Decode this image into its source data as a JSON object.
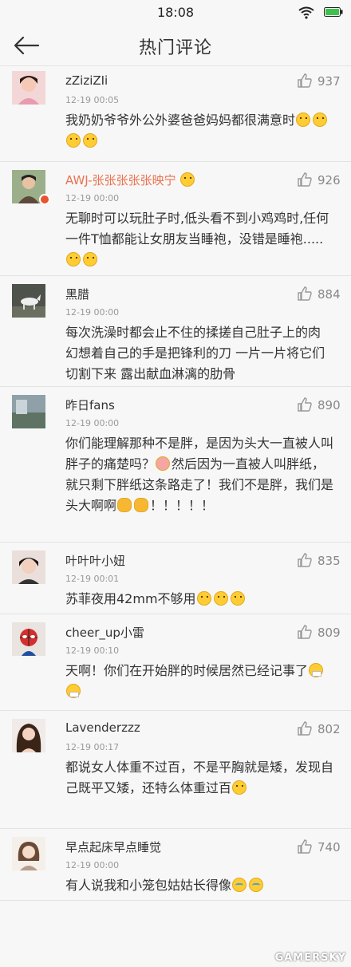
{
  "status_bar": {
    "time": "18:08",
    "wifi_icon": "wifi-icon",
    "battery_icon": "battery-icon"
  },
  "nav": {
    "back_icon": "back-arrow-icon",
    "title": "热门评论"
  },
  "comments": [
    {
      "user": "zZiziZIi",
      "time": "12-19 00:05",
      "likes": "937",
      "avatar": "avatar-girl-pink",
      "text": "我奶奶爷爷外公外婆爸爸妈妈都很满意时",
      "emojis": [
        "face",
        "face",
        "face",
        "face"
      ]
    },
    {
      "user": "AWJ-张张张张张映宁",
      "time": "12-19 00:00",
      "likes": "926",
      "avatar": "avatar-boy-green",
      "vip": true,
      "text": "无聊时可以玩肚子时,低头看不到小鸡鸡时,任何一件T恤都能让女朋友当睡袍，没错是睡袍.....",
      "emojis": [
        "face",
        "face"
      ]
    },
    {
      "user": "黑腊",
      "time": "12-19 00:00",
      "likes": "884",
      "avatar": "avatar-white-horse",
      "text": "每次洗澡时都会止不住的揉搓自己肚子上的肉 幻想着自己的手是把锋利的刀 一片一片将它们切割下来 露出献血淋漓的肋骨",
      "emojis": []
    },
    {
      "user": "昨日fans",
      "time": "12-19 00:00",
      "likes": "890",
      "avatar": "avatar-landscape",
      "text_parts": [
        "你们能理解那种不是胖，是因为头大一直被人叫胖子的痛楚吗？",
        "然后因为一直被人叫胖纸，就只剩下胖纸这条路走了！我们不是胖，我们是头大啊啊",
        "！！！！！"
      ],
      "emojis_mid": [
        "cover"
      ],
      "emojis_end": [
        "cat",
        "cat"
      ]
    },
    {
      "user": "叶叶叶小妞",
      "time": "12-19 00:01",
      "likes": "835",
      "avatar": "avatar-girl-dark",
      "text": "苏菲夜用42mm不够用",
      "emojis": [
        "face",
        "face",
        "face"
      ]
    },
    {
      "user": "cheer_up小雷",
      "time": "12-19 00:10",
      "likes": "809",
      "avatar": "avatar-spiderman",
      "text": "天啊！你们在开始胖的时候居然已经记事了",
      "emojis": [
        "mask",
        "mask"
      ]
    },
    {
      "user": "Lavenderzzz",
      "time": "12-19 00:17",
      "likes": "802",
      "avatar": "avatar-girl-long-hair",
      "text": "都说女人体重不过百，不是平胸就是矮，发现自己既平又矮，还特么体重过百",
      "emojis": [
        "face"
      ]
    },
    {
      "user": "早点起床早点睡觉",
      "time": "12-19 00:00",
      "likes": "740",
      "avatar": "avatar-girl-light",
      "text": "有人说我和小笼包姑姑长得像",
      "emojis": [
        "cry",
        "cry"
      ]
    }
  ],
  "watermark": "GAMERSKY",
  "colors": {
    "vip_name": "#eb7350",
    "background": "#f7f7f7",
    "divider": "#e3e3e3"
  }
}
